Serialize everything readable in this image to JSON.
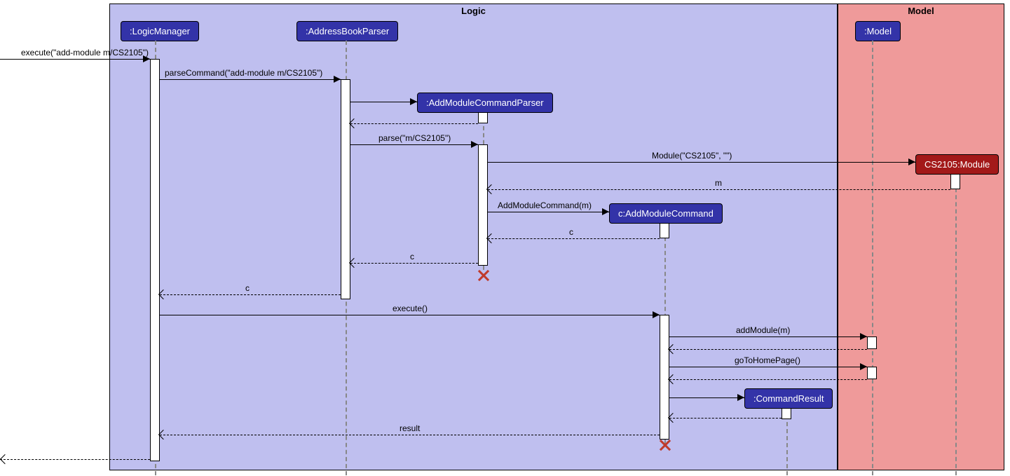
{
  "regions": {
    "logic": {
      "label": "Logic"
    },
    "model": {
      "label": "Model"
    }
  },
  "participants": {
    "logicManager": ":LogicManager",
    "addressBookParser": ":AddressBookParser",
    "addModuleCommandParser": ":AddModuleCommandParser",
    "addModuleCommand": "c:AddModuleCommand",
    "commandResult": ":CommandResult",
    "model": ":Model",
    "moduleObj": "CS2105:Module"
  },
  "messages": {
    "executeIn": "execute(\"add-module m/CS2105\")",
    "parseCommand": "parseCommand(\"add-module m/CS2105\")",
    "parse": "parse(\"m/CS2105\")",
    "moduleCtor": "Module(\"CS2105\", \"\")",
    "returnM": "m",
    "addModuleCmdCtor": "AddModuleCommand(m)",
    "returnC1": "c",
    "returnC2": "c",
    "returnC3": "c",
    "executeEmpty": "execute()",
    "addModule": "addModule(m)",
    "goHome": "goToHomePage()",
    "result": "result"
  }
}
